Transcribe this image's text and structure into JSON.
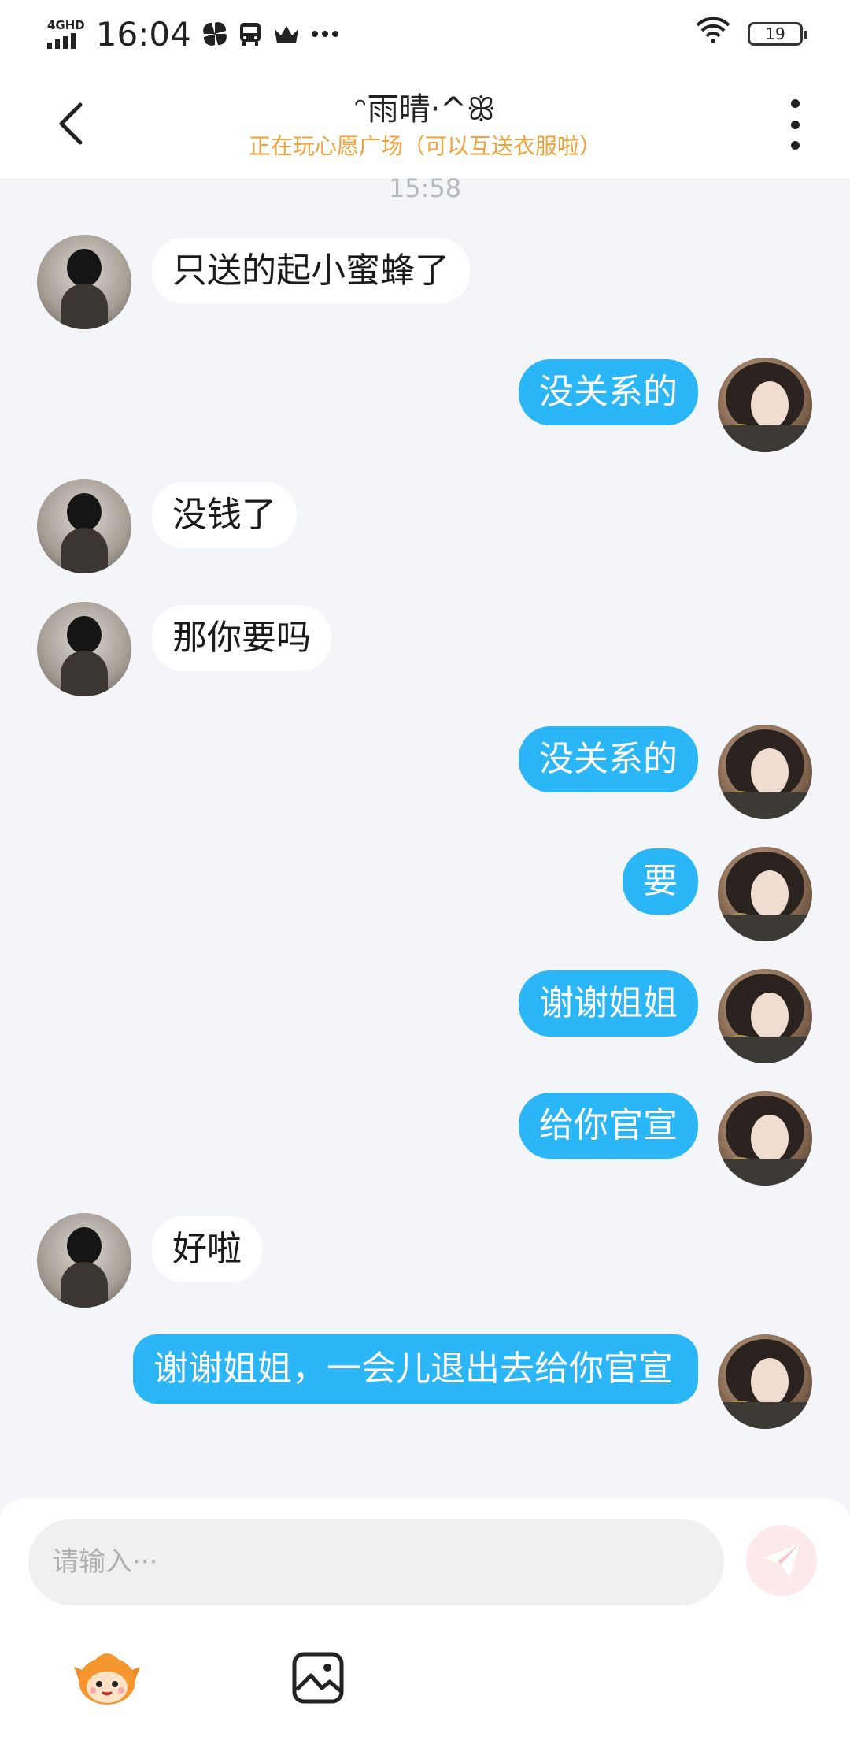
{
  "status_bar": {
    "network": "4GHD",
    "time": "16:04",
    "battery": "19"
  },
  "header": {
    "title": "ᵔ雨晴·^ꕥ",
    "subtitle": "正在玩心愿广场（可以互送衣服啦）"
  },
  "time_marker": "15:58",
  "messages": [
    {
      "side": "in",
      "text": "只送的起小蜜蜂了"
    },
    {
      "side": "out",
      "text": "没关系的"
    },
    {
      "side": "in",
      "text": "没钱了"
    },
    {
      "side": "in",
      "text": "那你要吗"
    },
    {
      "side": "out",
      "text": "没关系的"
    },
    {
      "side": "out",
      "text": "要"
    },
    {
      "side": "out",
      "text": "谢谢姐姐"
    },
    {
      "side": "out",
      "text": "给你官宣"
    },
    {
      "side": "in",
      "text": "好啦"
    },
    {
      "side": "out",
      "text": "谢谢姐姐，一会儿退出去给你官宣"
    }
  ],
  "composer": {
    "placeholder": "请输入···",
    "value": ""
  },
  "icons": {
    "back": "chevron-left-icon",
    "more": "more-vertical-icon",
    "send": "send-icon",
    "emoji": "mascot-emoji-icon",
    "image": "image-icon"
  },
  "colors": {
    "accent_bubble": "#2bb6f7",
    "subtitle": "#f0a23a",
    "background": "#f3f5f8"
  }
}
